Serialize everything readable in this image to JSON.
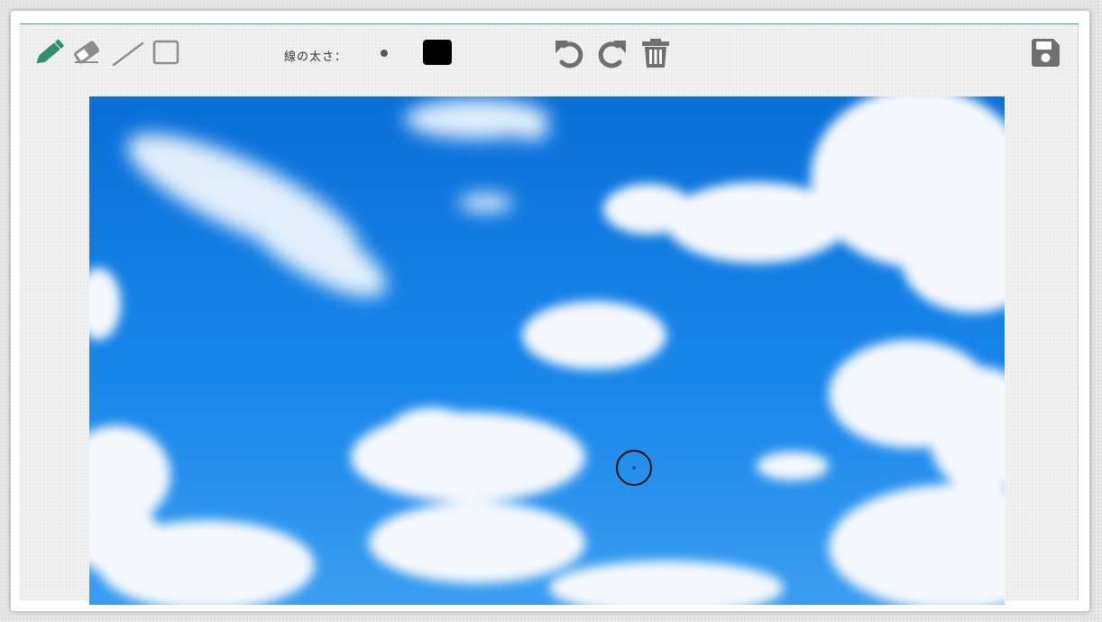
{
  "toolbar": {
    "tools": [
      {
        "icon": "pencil-icon",
        "label": "pencil",
        "active": true
      },
      {
        "icon": "eraser-icon",
        "label": "eraser",
        "active": false
      },
      {
        "icon": "line-icon",
        "label": "line",
        "active": false
      },
      {
        "icon": "rectangle-icon",
        "label": "rectangle",
        "active": false
      }
    ],
    "line_width_label": "線の太さ：",
    "line_width_icon": "dot-icon",
    "stroke_color": "#000000",
    "actions": [
      {
        "icon": "undo-icon"
      },
      {
        "icon": "redo-icon"
      },
      {
        "icon": "trash-icon"
      }
    ],
    "save_icon": "save-icon"
  },
  "canvas": {
    "background": "sky-with-clouds-image",
    "cursor": "brush-circle-cursor"
  },
  "colors": {
    "active_tool": "#2e8f6f",
    "inactive_tool": "#8c8c8c",
    "action_icons": "#6f6f6f",
    "frame_accent": "#3b9d8f"
  }
}
